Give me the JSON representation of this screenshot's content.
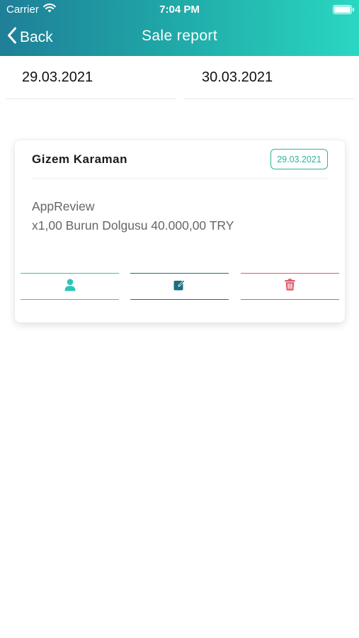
{
  "status_bar": {
    "carrier": "Carrier",
    "time": "7:04 PM"
  },
  "nav": {
    "back_label": "Back",
    "title": "Sale report"
  },
  "filters": {
    "date_from": "29.03.2021",
    "date_to": "30.03.2021"
  },
  "sales": [
    {
      "customer": "Gizem Karaman",
      "date": "29.03.2021",
      "source": "AppReview",
      "line_item": "x1,00 Burun Dolgusu 40.000,00 TRY",
      "actions": [
        {
          "icon": "user-icon",
          "color": "#2ac6b6"
        },
        {
          "icon": "edit-icon",
          "color": "#1c6e82"
        },
        {
          "icon": "trash-icon",
          "color": "#e25a68"
        }
      ]
    }
  ],
  "colors": {
    "header_start": "#1f7f98",
    "header_end": "#2ad7c2",
    "badge": "#2bb59a"
  }
}
